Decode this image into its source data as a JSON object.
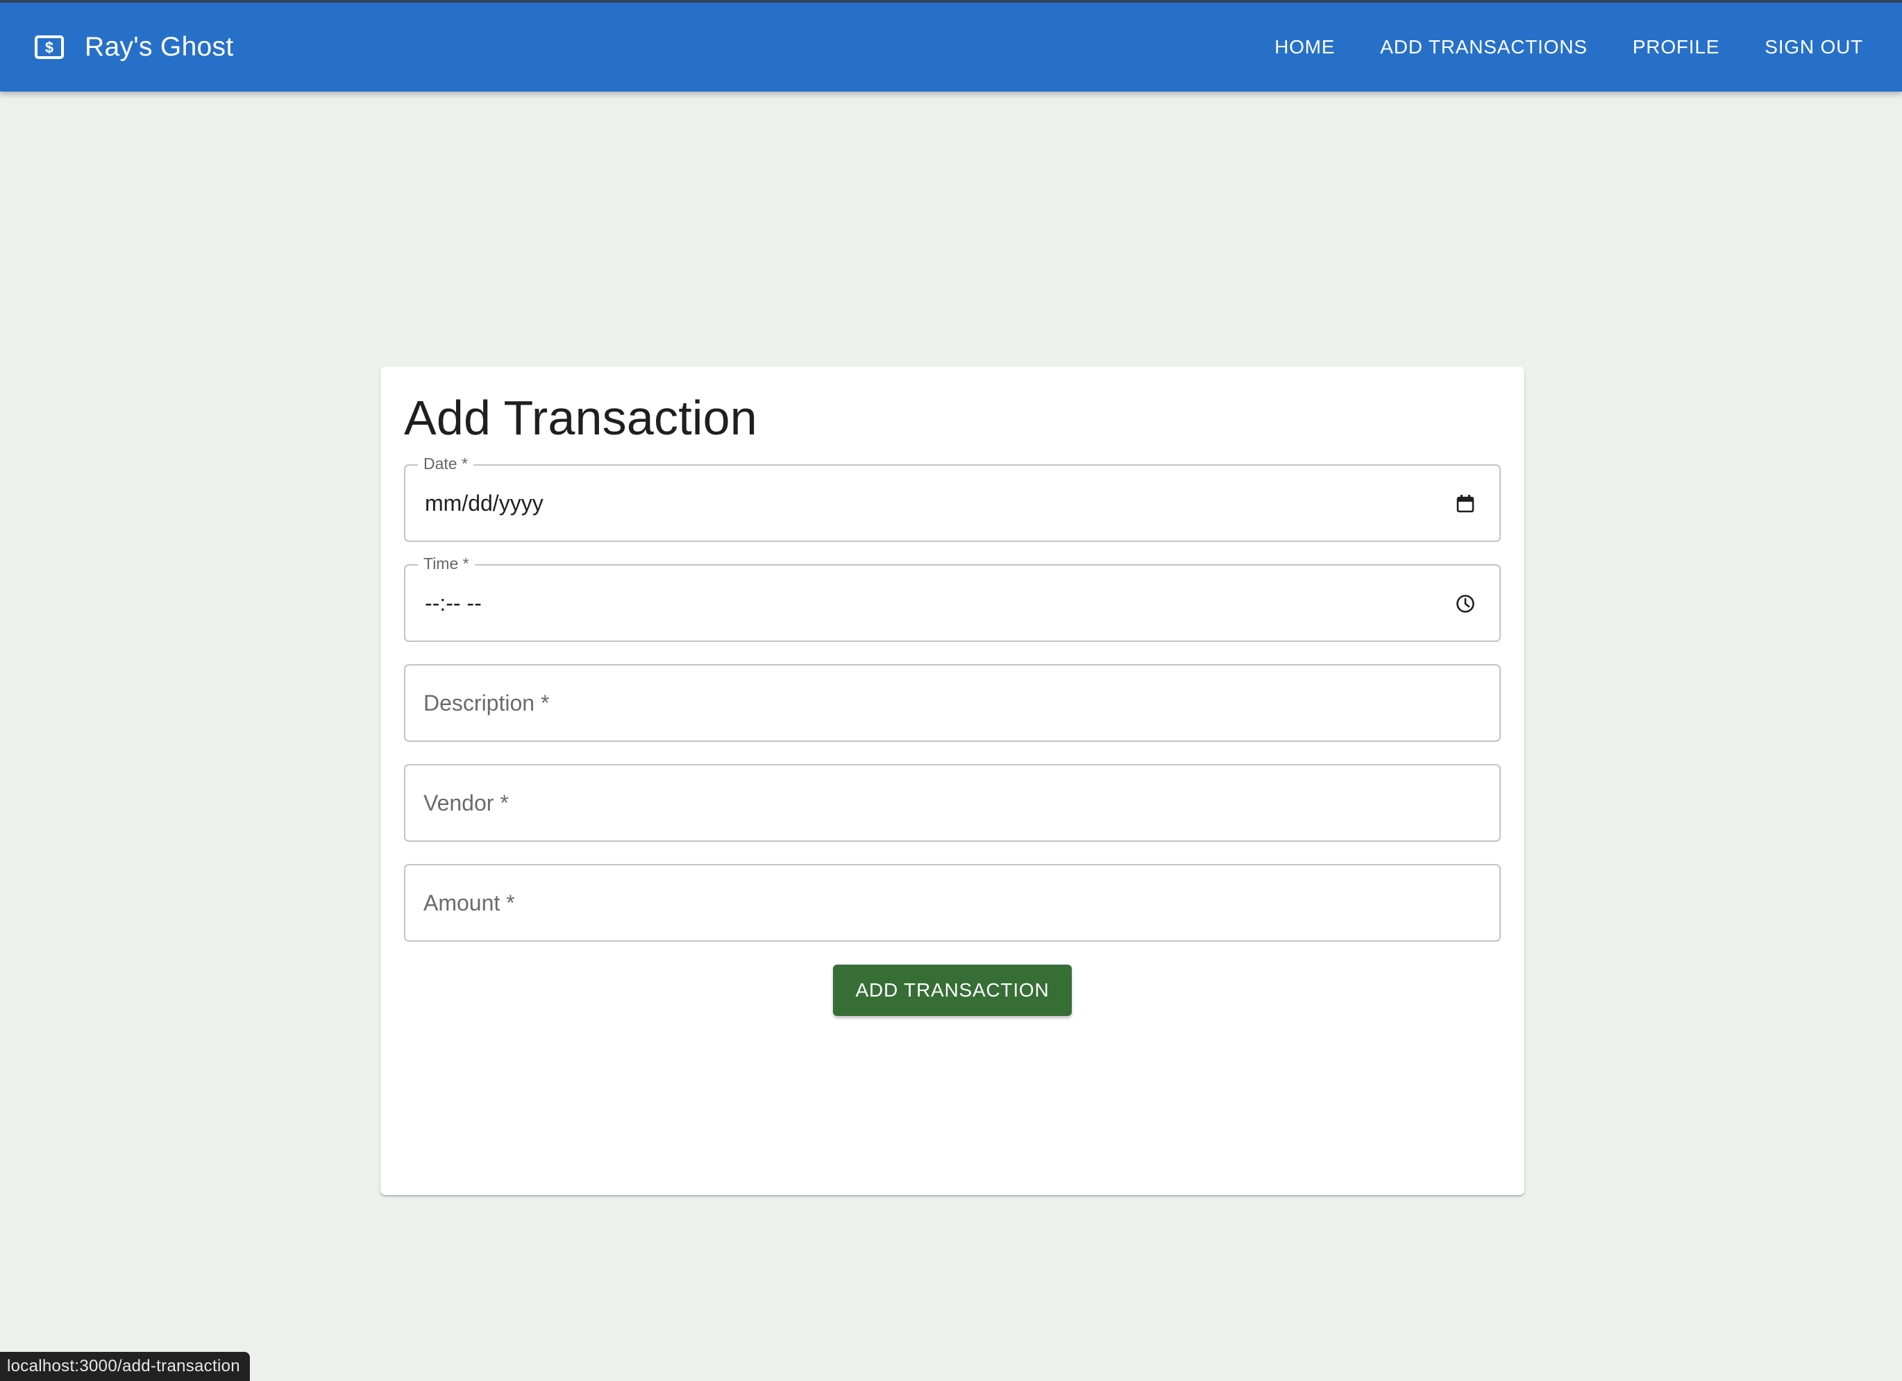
{
  "header": {
    "app_title": "Ray's Ghost",
    "brand_icon": "dollar-bill-icon",
    "nav": [
      {
        "label": "HOME"
      },
      {
        "label": "ADD TRANSACTIONS"
      },
      {
        "label": "PROFILE"
      },
      {
        "label": "SIGN OUT"
      }
    ]
  },
  "form": {
    "title": "Add Transaction",
    "date": {
      "label": "Date *",
      "value": "mm/dd/yyyy",
      "icon": "calendar-icon"
    },
    "time": {
      "label": "Time *",
      "value": "--:-- --",
      "icon": "clock-icon"
    },
    "description": {
      "placeholder": "Description *"
    },
    "vendor": {
      "placeholder": "Vendor *"
    },
    "amount": {
      "placeholder": "Amount *"
    },
    "submit_label": "ADD TRANSACTION"
  },
  "status_bar": {
    "url": "localhost:3000/add-transaction"
  },
  "colors": {
    "appbar": "#2770c9",
    "background": "#ecf1ec",
    "submit_button": "#376e36"
  }
}
